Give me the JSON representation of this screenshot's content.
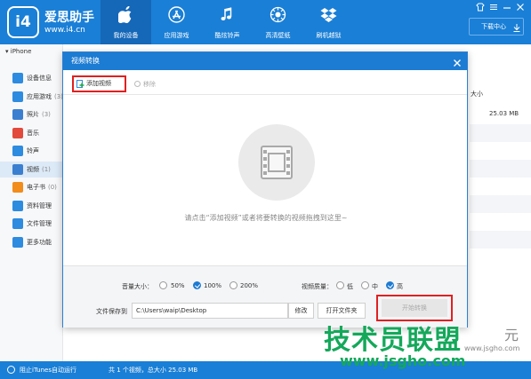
{
  "header": {
    "brand": "爱思助手",
    "brand_url": "www.i4.cn",
    "logo_mark": "i4",
    "nav": [
      {
        "label": "我的设备",
        "icon": "apple-icon",
        "active": true
      },
      {
        "label": "应用游戏",
        "icon": "app-store-icon",
        "active": false
      },
      {
        "label": "酷炫铃声",
        "icon": "music-note-icon",
        "active": false
      },
      {
        "label": "高清壁纸",
        "icon": "wallpaper-icon",
        "active": false
      },
      {
        "label": "刷机越狱",
        "icon": "dropbox-icon",
        "active": false
      }
    ],
    "download_label": "下载中心"
  },
  "sidebar": {
    "device": "iPhone",
    "items": [
      {
        "label": "设备信息",
        "count": "",
        "icon": "info-icon",
        "color": "#2d8be0"
      },
      {
        "label": "应用游戏",
        "count": "(3)",
        "icon": "apps-icon",
        "color": "#2d8be0"
      },
      {
        "label": "照片",
        "count": "(3)",
        "icon": "photo-icon",
        "color": "#3b7fd0"
      },
      {
        "label": "音乐",
        "count": "",
        "icon": "music-icon",
        "color": "#e24a3b"
      },
      {
        "label": "铃声",
        "count": "",
        "icon": "bell-icon",
        "color": "#2d8be0"
      },
      {
        "label": "视频",
        "count": "(1)",
        "icon": "video-icon",
        "color": "#3b7fd0"
      },
      {
        "label": "电子书",
        "count": "(0)",
        "icon": "ebook-icon",
        "color": "#f28c1b"
      },
      {
        "label": "资料管理",
        "count": "",
        "icon": "contacts-icon",
        "color": "#2d8be0"
      },
      {
        "label": "文件管理",
        "count": "",
        "icon": "folder-icon",
        "color": "#2d8be0"
      },
      {
        "label": "更多功能",
        "count": "",
        "icon": "grid-icon",
        "color": "#2d8be0"
      }
    ]
  },
  "background": {
    "size_header": "大小",
    "size_value": "25.03 MB"
  },
  "dialog": {
    "title": "视频转换",
    "add_video": "添加视频",
    "remove": "移除",
    "empty_hint": "请点击“添加视频”或者将要转换的视频拖拽到这里~",
    "volume_label": "音量大小：",
    "volume_options": [
      {
        "label": "50%",
        "checked": false
      },
      {
        "label": "100%",
        "checked": true
      },
      {
        "label": "200%",
        "checked": false
      }
    ],
    "quality_label": "视频质量：",
    "quality_options": [
      {
        "label": "低",
        "checked": false
      },
      {
        "label": "中",
        "checked": false
      },
      {
        "label": "高",
        "checked": true
      }
    ],
    "save_label": "文件保存到",
    "save_path": "C:\\Users\\waip\\Desktop",
    "modify_button": "修改",
    "open_folder_button": "打开文件夹",
    "start_button": "开始转换"
  },
  "status": {
    "itunes_toggle": "阻止iTunes自动运行",
    "summary": "共 1 个视频，总大小 25.03 MB"
  },
  "watermark": {
    "main": "技术员联盟",
    "small": "元",
    "url": "www.jsgho.com",
    "url2": "www.jsgho.com"
  },
  "colors": {
    "header_blue": "#1a7fd6",
    "highlight_red": "#e02020",
    "watermark_green": "#14a85a"
  }
}
